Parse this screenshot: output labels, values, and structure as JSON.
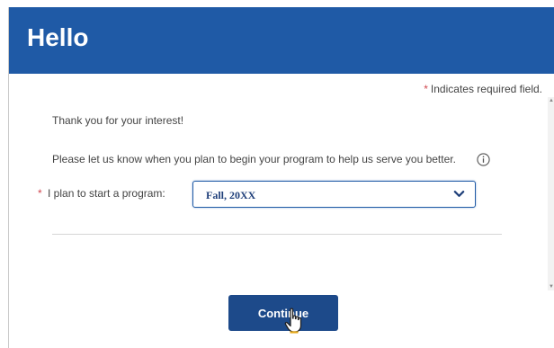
{
  "header": {
    "title": "Hello"
  },
  "form": {
    "required_note": "Indicates required field.",
    "required_marker": "*",
    "thank_you": "Thank you for your interest!",
    "prompt": "Please let us know when you plan to begin your program to help us serve you better.",
    "field_label": "I plan to start a program:",
    "selected_value": "Fall, 20XX",
    "continue_label": "Continue"
  },
  "icons": {
    "info": "info-icon",
    "dropdown": "chevron-down-icon",
    "cursor": "hand-cursor-icon"
  },
  "colors": {
    "header_bg": "#1f5aa6",
    "button_bg": "#1d4a8a",
    "required": "#d0474f",
    "select_text": "#1f3f7a"
  }
}
